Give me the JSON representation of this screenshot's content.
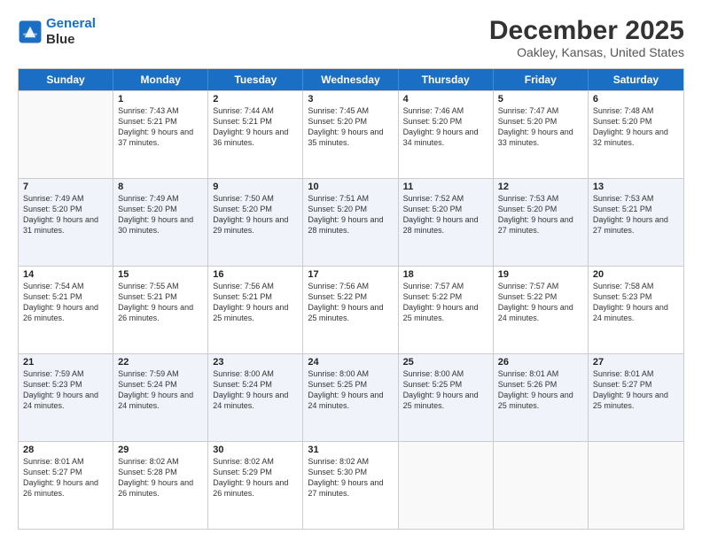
{
  "header": {
    "logo_line1": "General",
    "logo_line2": "Blue",
    "month": "December 2025",
    "location": "Oakley, Kansas, United States"
  },
  "days_of_week": [
    "Sunday",
    "Monday",
    "Tuesday",
    "Wednesday",
    "Thursday",
    "Friday",
    "Saturday"
  ],
  "weeks": [
    [
      {
        "day": "",
        "sunrise": "",
        "sunset": "",
        "daylight": ""
      },
      {
        "day": "1",
        "sunrise": "Sunrise: 7:43 AM",
        "sunset": "Sunset: 5:21 PM",
        "daylight": "Daylight: 9 hours and 37 minutes."
      },
      {
        "day": "2",
        "sunrise": "Sunrise: 7:44 AM",
        "sunset": "Sunset: 5:21 PM",
        "daylight": "Daylight: 9 hours and 36 minutes."
      },
      {
        "day": "3",
        "sunrise": "Sunrise: 7:45 AM",
        "sunset": "Sunset: 5:20 PM",
        "daylight": "Daylight: 9 hours and 35 minutes."
      },
      {
        "day": "4",
        "sunrise": "Sunrise: 7:46 AM",
        "sunset": "Sunset: 5:20 PM",
        "daylight": "Daylight: 9 hours and 34 minutes."
      },
      {
        "day": "5",
        "sunrise": "Sunrise: 7:47 AM",
        "sunset": "Sunset: 5:20 PM",
        "daylight": "Daylight: 9 hours and 33 minutes."
      },
      {
        "day": "6",
        "sunrise": "Sunrise: 7:48 AM",
        "sunset": "Sunset: 5:20 PM",
        "daylight": "Daylight: 9 hours and 32 minutes."
      }
    ],
    [
      {
        "day": "7",
        "sunrise": "Sunrise: 7:49 AM",
        "sunset": "Sunset: 5:20 PM",
        "daylight": "Daylight: 9 hours and 31 minutes."
      },
      {
        "day": "8",
        "sunrise": "Sunrise: 7:49 AM",
        "sunset": "Sunset: 5:20 PM",
        "daylight": "Daylight: 9 hours and 30 minutes."
      },
      {
        "day": "9",
        "sunrise": "Sunrise: 7:50 AM",
        "sunset": "Sunset: 5:20 PM",
        "daylight": "Daylight: 9 hours and 29 minutes."
      },
      {
        "day": "10",
        "sunrise": "Sunrise: 7:51 AM",
        "sunset": "Sunset: 5:20 PM",
        "daylight": "Daylight: 9 hours and 28 minutes."
      },
      {
        "day": "11",
        "sunrise": "Sunrise: 7:52 AM",
        "sunset": "Sunset: 5:20 PM",
        "daylight": "Daylight: 9 hours and 28 minutes."
      },
      {
        "day": "12",
        "sunrise": "Sunrise: 7:53 AM",
        "sunset": "Sunset: 5:20 PM",
        "daylight": "Daylight: 9 hours and 27 minutes."
      },
      {
        "day": "13",
        "sunrise": "Sunrise: 7:53 AM",
        "sunset": "Sunset: 5:21 PM",
        "daylight": "Daylight: 9 hours and 27 minutes."
      }
    ],
    [
      {
        "day": "14",
        "sunrise": "Sunrise: 7:54 AM",
        "sunset": "Sunset: 5:21 PM",
        "daylight": "Daylight: 9 hours and 26 minutes."
      },
      {
        "day": "15",
        "sunrise": "Sunrise: 7:55 AM",
        "sunset": "Sunset: 5:21 PM",
        "daylight": "Daylight: 9 hours and 26 minutes."
      },
      {
        "day": "16",
        "sunrise": "Sunrise: 7:56 AM",
        "sunset": "Sunset: 5:21 PM",
        "daylight": "Daylight: 9 hours and 25 minutes."
      },
      {
        "day": "17",
        "sunrise": "Sunrise: 7:56 AM",
        "sunset": "Sunset: 5:22 PM",
        "daylight": "Daylight: 9 hours and 25 minutes."
      },
      {
        "day": "18",
        "sunrise": "Sunrise: 7:57 AM",
        "sunset": "Sunset: 5:22 PM",
        "daylight": "Daylight: 9 hours and 25 minutes."
      },
      {
        "day": "19",
        "sunrise": "Sunrise: 7:57 AM",
        "sunset": "Sunset: 5:22 PM",
        "daylight": "Daylight: 9 hours and 24 minutes."
      },
      {
        "day": "20",
        "sunrise": "Sunrise: 7:58 AM",
        "sunset": "Sunset: 5:23 PM",
        "daylight": "Daylight: 9 hours and 24 minutes."
      }
    ],
    [
      {
        "day": "21",
        "sunrise": "Sunrise: 7:59 AM",
        "sunset": "Sunset: 5:23 PM",
        "daylight": "Daylight: 9 hours and 24 minutes."
      },
      {
        "day": "22",
        "sunrise": "Sunrise: 7:59 AM",
        "sunset": "Sunset: 5:24 PM",
        "daylight": "Daylight: 9 hours and 24 minutes."
      },
      {
        "day": "23",
        "sunrise": "Sunrise: 8:00 AM",
        "sunset": "Sunset: 5:24 PM",
        "daylight": "Daylight: 9 hours and 24 minutes."
      },
      {
        "day": "24",
        "sunrise": "Sunrise: 8:00 AM",
        "sunset": "Sunset: 5:25 PM",
        "daylight": "Daylight: 9 hours and 24 minutes."
      },
      {
        "day": "25",
        "sunrise": "Sunrise: 8:00 AM",
        "sunset": "Sunset: 5:25 PM",
        "daylight": "Daylight: 9 hours and 25 minutes."
      },
      {
        "day": "26",
        "sunrise": "Sunrise: 8:01 AM",
        "sunset": "Sunset: 5:26 PM",
        "daylight": "Daylight: 9 hours and 25 minutes."
      },
      {
        "day": "27",
        "sunrise": "Sunrise: 8:01 AM",
        "sunset": "Sunset: 5:27 PM",
        "daylight": "Daylight: 9 hours and 25 minutes."
      }
    ],
    [
      {
        "day": "28",
        "sunrise": "Sunrise: 8:01 AM",
        "sunset": "Sunset: 5:27 PM",
        "daylight": "Daylight: 9 hours and 26 minutes."
      },
      {
        "day": "29",
        "sunrise": "Sunrise: 8:02 AM",
        "sunset": "Sunset: 5:28 PM",
        "daylight": "Daylight: 9 hours and 26 minutes."
      },
      {
        "day": "30",
        "sunrise": "Sunrise: 8:02 AM",
        "sunset": "Sunset: 5:29 PM",
        "daylight": "Daylight: 9 hours and 26 minutes."
      },
      {
        "day": "31",
        "sunrise": "Sunrise: 8:02 AM",
        "sunset": "Sunset: 5:30 PM",
        "daylight": "Daylight: 9 hours and 27 minutes."
      },
      {
        "day": "",
        "sunrise": "",
        "sunset": "",
        "daylight": ""
      },
      {
        "day": "",
        "sunrise": "",
        "sunset": "",
        "daylight": ""
      },
      {
        "day": "",
        "sunrise": "",
        "sunset": "",
        "daylight": ""
      }
    ]
  ]
}
